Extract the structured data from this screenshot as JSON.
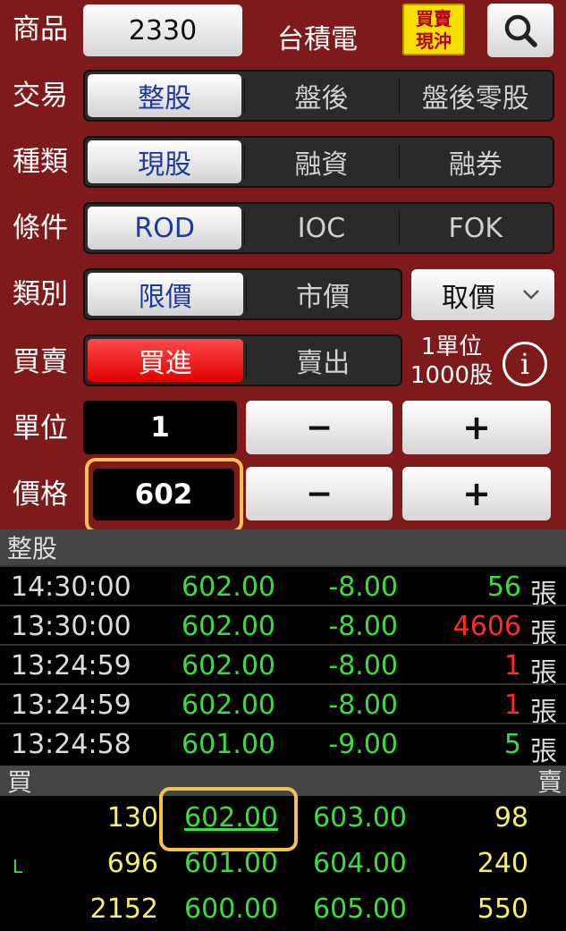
{
  "form": {
    "product": {
      "label": "商品",
      "code": "2330",
      "name": "台積電",
      "toggle_line1": "買賣",
      "toggle_line2": "現沖",
      "search_icon": "search-icon"
    },
    "trade": {
      "label": "交易",
      "options": [
        "整股",
        "盤後",
        "盤後零股"
      ],
      "selected": 0
    },
    "kind": {
      "label": "種類",
      "options": [
        "現股",
        "融資",
        "融券"
      ],
      "selected": 0
    },
    "condition": {
      "label": "條件",
      "options": [
        "ROD",
        "IOC",
        "FOK"
      ],
      "selected": 0
    },
    "category": {
      "label": "類別",
      "options": [
        "限價",
        "市價"
      ],
      "selected": 0,
      "take_price": "取價"
    },
    "side": {
      "label": "買賣",
      "options": [
        "買進",
        "賣出"
      ],
      "selected": 0,
      "unit_line1": "1單位",
      "unit_line2": "1000股"
    },
    "unit": {
      "label": "單位",
      "value": "1",
      "minus": "−",
      "plus": "+"
    },
    "price": {
      "label": "價格",
      "value": "602",
      "minus": "−",
      "plus": "+"
    }
  },
  "ticks": {
    "header": "整股",
    "unit": "張",
    "rows": [
      {
        "time": "14:30:00",
        "price": "602.00",
        "change": "-8.00",
        "volume": "56",
        "vol_color": "#3ddc3d"
      },
      {
        "time": "13:30:00",
        "price": "602.00",
        "change": "-8.00",
        "volume": "4606",
        "vol_color": "#ff2a2a"
      },
      {
        "time": "13:24:59",
        "price": "602.00",
        "change": "-8.00",
        "volume": "1",
        "vol_color": "#ff2a2a"
      },
      {
        "time": "13:24:59",
        "price": "602.00",
        "change": "-8.00",
        "volume": "1",
        "vol_color": "#ff2a2a"
      },
      {
        "time": "13:24:58",
        "price": "601.00",
        "change": "-9.00",
        "volume": "5",
        "vol_color": "#3ddc3d"
      }
    ]
  },
  "book": {
    "buy_label": "買",
    "sell_label": "賣",
    "rows": [
      {
        "flag": "",
        "bid_qty": "130",
        "bid": "602.00",
        "ask": "603.00",
        "ask_qty": "98"
      },
      {
        "flag": "L",
        "bid_qty": "696",
        "bid": "601.00",
        "ask": "604.00",
        "ask_qty": "240"
      },
      {
        "flag": "",
        "bid_qty": "2152",
        "bid": "600.00",
        "ask": "605.00",
        "ask_qty": "550"
      }
    ]
  },
  "colors": {
    "panel": "#7f1a1a",
    "selected_text": "#1f3a9c",
    "buy": "#e00000",
    "up_green": "#3ddc3d",
    "highlight": "#f2c14e"
  }
}
